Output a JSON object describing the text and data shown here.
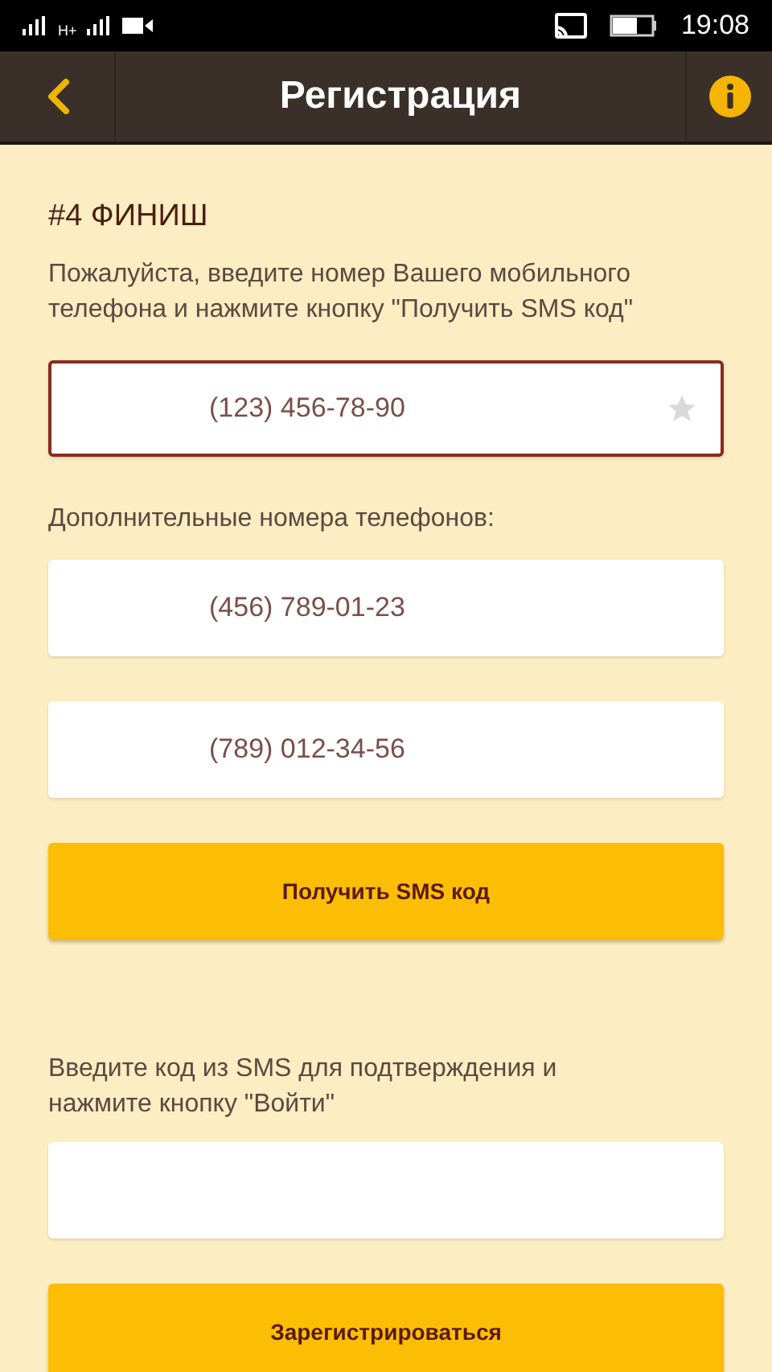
{
  "status_bar": {
    "network": "H+",
    "time": "19:08"
  },
  "header": {
    "title": "Регистрация"
  },
  "step_title": "#4 ФИНИШ",
  "instruction": "Пожалуйста, введите номер Вашего мобильного телефона и нажмите кнопку \"Получить SMS код\"",
  "main_phone": {
    "value": "(123) 456-78-90",
    "focused": true,
    "starred": false
  },
  "extra_label": "Дополнительные номера телефонов:",
  "extra_phones": [
    {
      "value": "(456) 789-01-23",
      "focused": false
    },
    {
      "value": "(789) 012-34-56",
      "focused": false
    }
  ],
  "sms_button": "Получить SMS код",
  "code_instruction": "Введите код из SMS для подтверждения и нажмите кнопку \"Войти\"",
  "code_field": {
    "focused": false
  },
  "register_button": "Зарегистрироваться"
}
